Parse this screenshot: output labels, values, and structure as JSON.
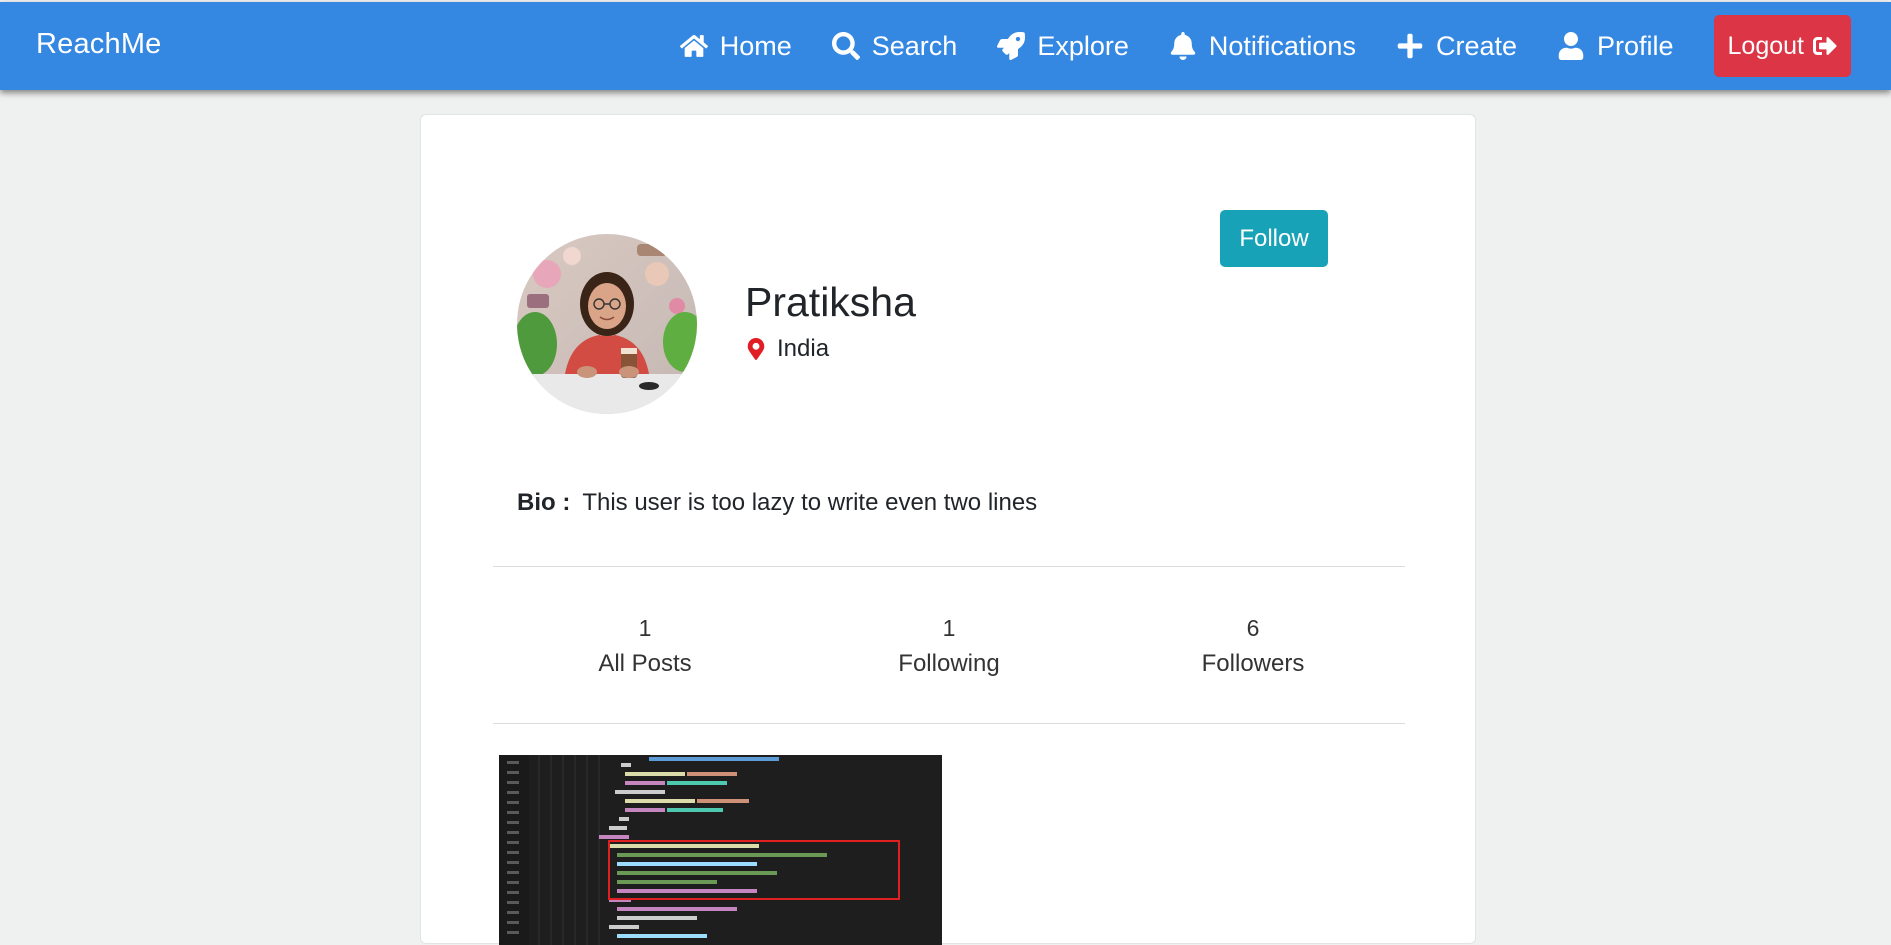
{
  "navbar": {
    "brand": "ReachMe",
    "items": [
      {
        "label": "Home",
        "icon": "home-icon"
      },
      {
        "label": "Search",
        "icon": "search-icon"
      },
      {
        "label": "Explore",
        "icon": "rocket-icon"
      },
      {
        "label": "Notifications",
        "icon": "bell-icon"
      },
      {
        "label": "Create",
        "icon": "plus-icon"
      },
      {
        "label": "Profile",
        "icon": "user-icon"
      }
    ],
    "logout_label": "Logout",
    "logout_icon": "sign-out-icon"
  },
  "profile": {
    "name": "Pratiksha",
    "location": "India",
    "follow_label": "Follow",
    "bio_label": "Bio :",
    "bio_text": "This user is too lazy to write even two lines",
    "stats": [
      {
        "count": "1",
        "label": "All Posts"
      },
      {
        "count": "1",
        "label": "Following"
      },
      {
        "count": "6",
        "label": "Followers"
      }
    ]
  },
  "colors": {
    "navbar": "#3588e2",
    "logout": "#dc3545",
    "follow": "#17a2b8",
    "location_pin": "#e01e24",
    "page_bg": "#eff1f0"
  }
}
